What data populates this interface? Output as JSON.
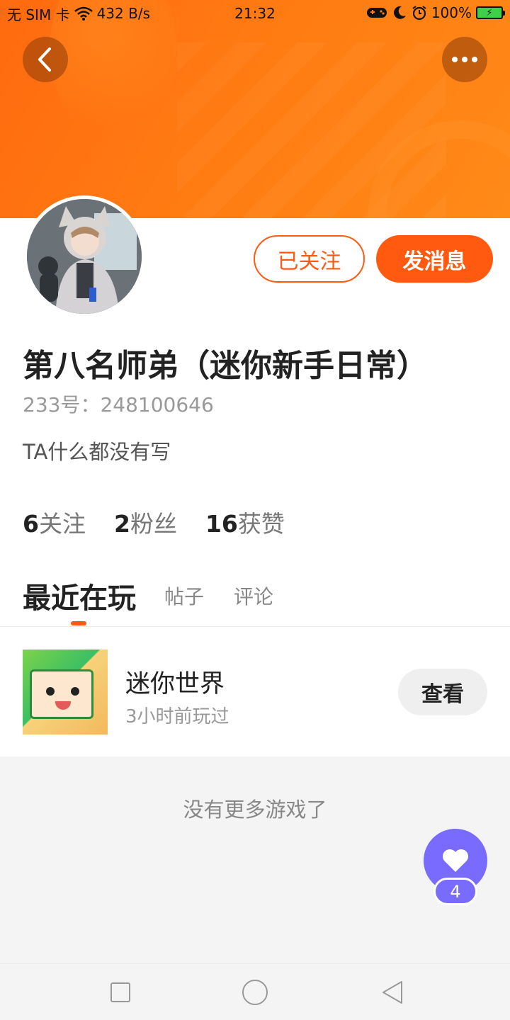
{
  "status_bar": {
    "carrier": "无 SIM 卡",
    "speed": "432 B/s",
    "time": "21:32",
    "battery": "100%"
  },
  "header": {
    "back_icon": "chevron-left-icon",
    "more_icon": "more-dots-icon",
    "banner_color": "#ff7512"
  },
  "profile": {
    "follow_label": "已关注",
    "message_label": "发消息",
    "name": "第八名师弟（迷你新手日常）",
    "id_text": "233号：248100646",
    "bio": "TA什么都没有写",
    "stats": {
      "following_count": "6",
      "following_label": "关注",
      "fans_count": "2",
      "fans_label": "粉丝",
      "likes_count": "16",
      "likes_label": "获赞"
    }
  },
  "tabs": [
    {
      "label": "最近在玩",
      "active": true
    },
    {
      "label": "帖子",
      "active": false
    },
    {
      "label": "评论",
      "active": false
    }
  ],
  "games": [
    {
      "name": "迷你世界",
      "played": "3小时前玩过",
      "action": "查看"
    }
  ],
  "footer_text": "没有更多游戏了",
  "like_fab": {
    "icon": "heart-icon",
    "count": "4",
    "color": "#7a6bff"
  },
  "accent": "#ff5a10"
}
